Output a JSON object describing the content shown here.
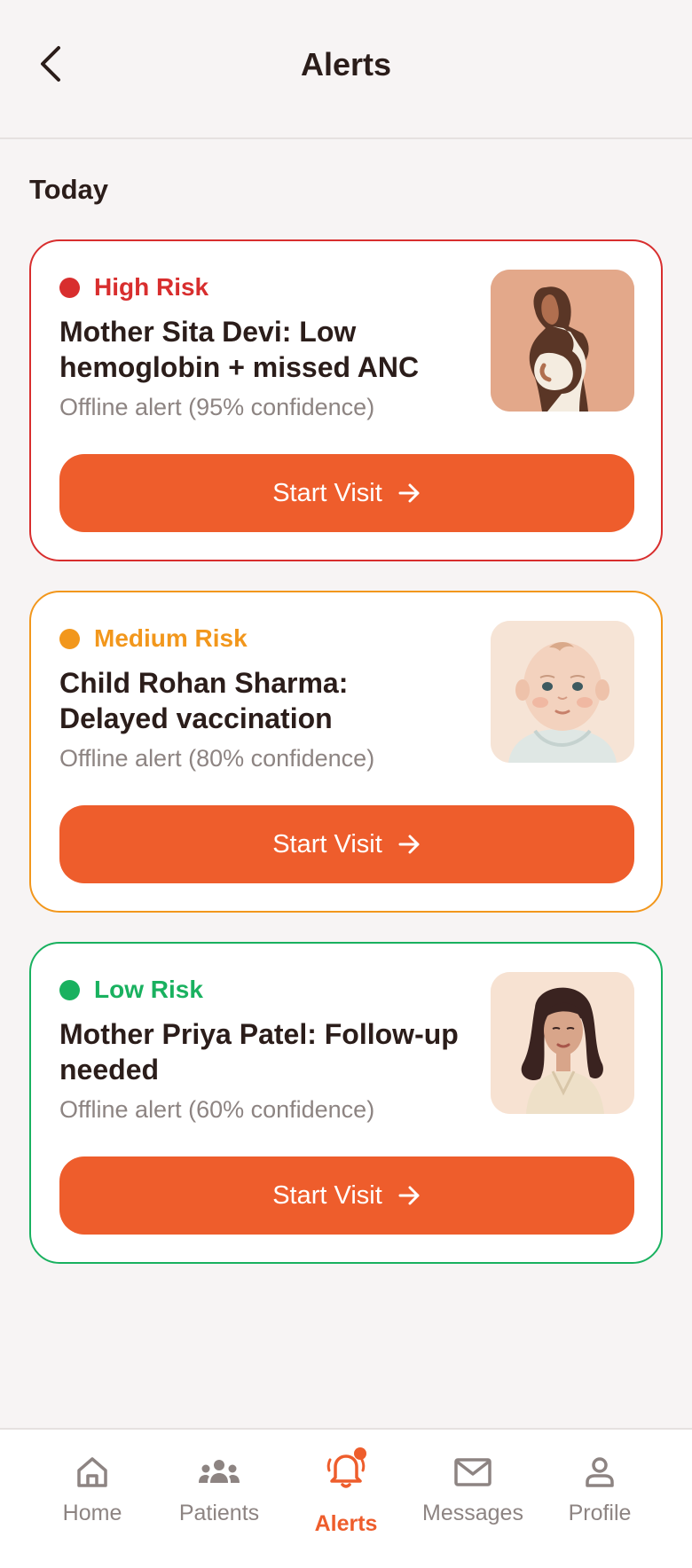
{
  "header": {
    "title": "Alerts"
  },
  "section": {
    "title": "Today"
  },
  "alerts": [
    {
      "risk": "High Risk",
      "risk_color": "#d82e2e",
      "title": "Mother Sita Devi: Low hemoglobin + missed ANC",
      "subtitle": "Offline alert (95% confidence)",
      "button": "Start Visit",
      "avatar": "pregnant-woman-illustration"
    },
    {
      "risk": "Medium Risk",
      "risk_color": "#f2971c",
      "title": "Child Rohan Sharma: Delayed vaccination",
      "subtitle": "Offline alert (80% confidence)",
      "button": "Start Visit",
      "avatar": "baby-illustration"
    },
    {
      "risk": "Low Risk",
      "risk_color": "#19b15f",
      "title": "Mother Priya Patel: Follow-up needed",
      "subtitle": "Offline alert (60% confidence)",
      "button": "Start Visit",
      "avatar": "woman-illustration"
    }
  ],
  "nav": {
    "items": [
      {
        "label": "Home",
        "icon": "home-icon"
      },
      {
        "label": "Patients",
        "icon": "people-icon"
      },
      {
        "label": "Alerts",
        "icon": "bell-icon",
        "active": true
      },
      {
        "label": "Messages",
        "icon": "mail-icon"
      },
      {
        "label": "Profile",
        "icon": "person-icon"
      }
    ]
  },
  "colors": {
    "accent": "#ee5d2c",
    "background": "#f7f4f4",
    "text": "#2b1d1a",
    "muted": "#8d8482"
  }
}
